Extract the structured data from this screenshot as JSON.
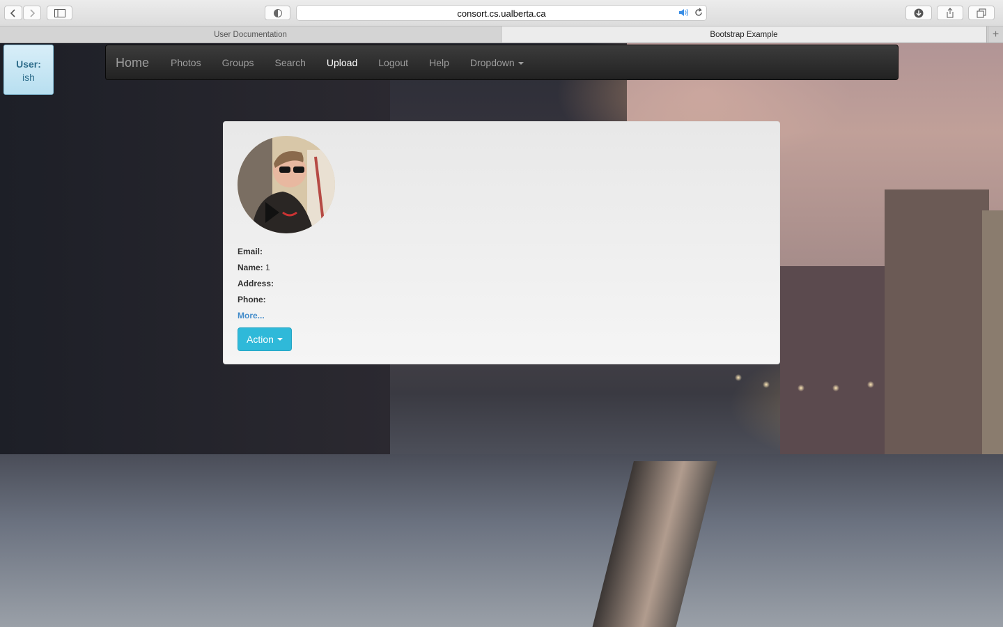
{
  "browser": {
    "url": "consort.cs.ualberta.ca",
    "tabs": [
      {
        "label": "User Documentation",
        "active": false
      },
      {
        "label": "Bootstrap Example",
        "active": true
      }
    ],
    "new_tab_icon": "plus-icon"
  },
  "user": {
    "label": "User:",
    "name": "ish"
  },
  "navbar": {
    "brand": "Home",
    "items": [
      {
        "label": "Photos",
        "active": false
      },
      {
        "label": "Groups",
        "active": false
      },
      {
        "label": "Search",
        "active": false
      },
      {
        "label": "Upload",
        "active": true
      },
      {
        "label": "Logout",
        "active": false
      },
      {
        "label": "Help",
        "active": false
      },
      {
        "label": "Dropdown",
        "active": false
      }
    ]
  },
  "profile": {
    "fields": [
      {
        "label": "Email:",
        "value": ""
      },
      {
        "label": "Name:",
        "value": "1"
      },
      {
        "label": "Address:",
        "value": ""
      },
      {
        "label": "Phone:",
        "value": ""
      }
    ],
    "more_link": "More...",
    "action_label": "Action"
  },
  "colors": {
    "navbar_bg": "#222222",
    "action_btn": "#2fb9d9",
    "user_badge": "#c4e5f3",
    "link": "#428bca"
  }
}
